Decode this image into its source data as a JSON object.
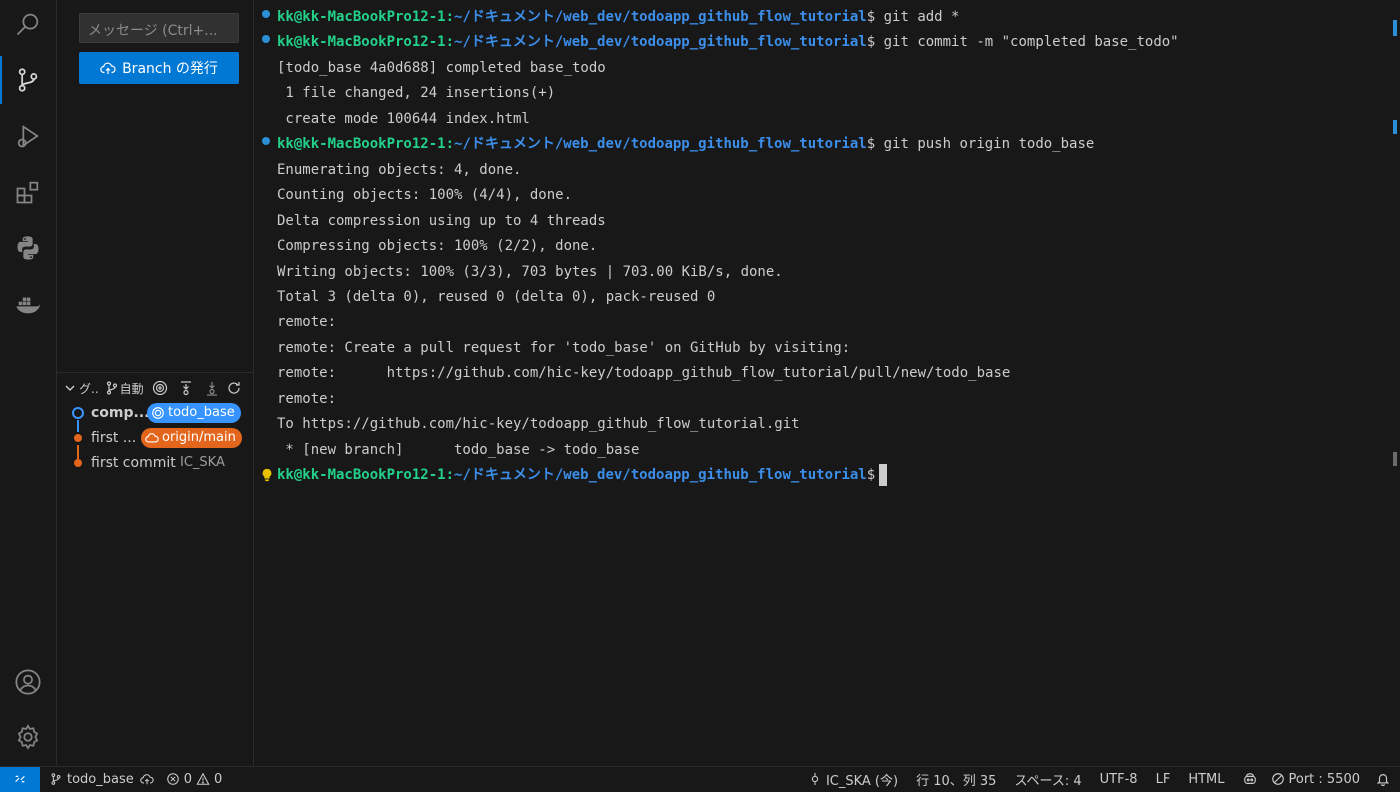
{
  "sidebar": {
    "message_placeholder": "メッセージ (Ctrl+...",
    "publish_label": "Branch の発行",
    "graph_header": {
      "title": "グ..",
      "auto_label": "自動"
    },
    "graph": [
      {
        "label": "comp...",
        "badge": "todo_base",
        "badge_color": "#3794ff",
        "dot_color": "#3794ff"
      },
      {
        "label": "first ...",
        "badge": "origin/main",
        "badge_color": "#e3661c",
        "dot_color": "#e3661c"
      },
      {
        "label": "first commit",
        "author": "IC_SKA",
        "dot_color": "#e3661c"
      }
    ]
  },
  "terminal": {
    "prompt_user": "kk@kk-MacBookPro12-1",
    "prompt_path": "~/ドキュメント/web_dev/todoapp_github_flow_tutorial",
    "lines": [
      {
        "type": "prompt",
        "cmd": "$ git add *"
      },
      {
        "type": "prompt",
        "cmd": "$ git commit -m \"completed base_todo\""
      },
      {
        "type": "out",
        "text": "[todo_base 4a0d688] completed base_todo"
      },
      {
        "type": "out",
        "text": " 1 file changed, 24 insertions(+)"
      },
      {
        "type": "out",
        "text": " create mode 100644 index.html"
      },
      {
        "type": "prompt",
        "cmd": "$ git push origin todo_base"
      },
      {
        "type": "out",
        "text": "Enumerating objects: 4, done."
      },
      {
        "type": "out",
        "text": "Counting objects: 100% (4/4), done."
      },
      {
        "type": "out",
        "text": "Delta compression using up to 4 threads"
      },
      {
        "type": "out",
        "text": "Compressing objects: 100% (2/2), done."
      },
      {
        "type": "out",
        "text": "Writing objects: 100% (3/3), 703 bytes | 703.00 KiB/s, done."
      },
      {
        "type": "out",
        "text": "Total 3 (delta 0), reused 0 (delta 0), pack-reused 0"
      },
      {
        "type": "out",
        "text": "remote:"
      },
      {
        "type": "out",
        "text": "remote: Create a pull request for 'todo_base' on GitHub by visiting:"
      },
      {
        "type": "out",
        "text": "remote:      https://github.com/hic-key/todoapp_github_flow_tutorial/pull/new/todo_base"
      },
      {
        "type": "out",
        "text": "remote:"
      },
      {
        "type": "out",
        "text": "To https://github.com/hic-key/todoapp_github_flow_tutorial.git"
      },
      {
        "type": "out",
        "text": " * [new branch]      todo_base -> todo_base"
      },
      {
        "type": "prompt",
        "cmd": "$",
        "current": true
      }
    ]
  },
  "statusbar": {
    "branch": "todo_base",
    "errors": "0",
    "warnings": "0",
    "commit_author": "IC_SKA (今)",
    "cursor_pos": "行 10、列 35",
    "indent": "スペース: 4",
    "encoding": "UTF-8",
    "eol": "LF",
    "language": "HTML",
    "port": "Port : 5500"
  },
  "colors": {
    "accent": "#0078d4",
    "user": "#23d18b",
    "path": "#3b8eea"
  }
}
